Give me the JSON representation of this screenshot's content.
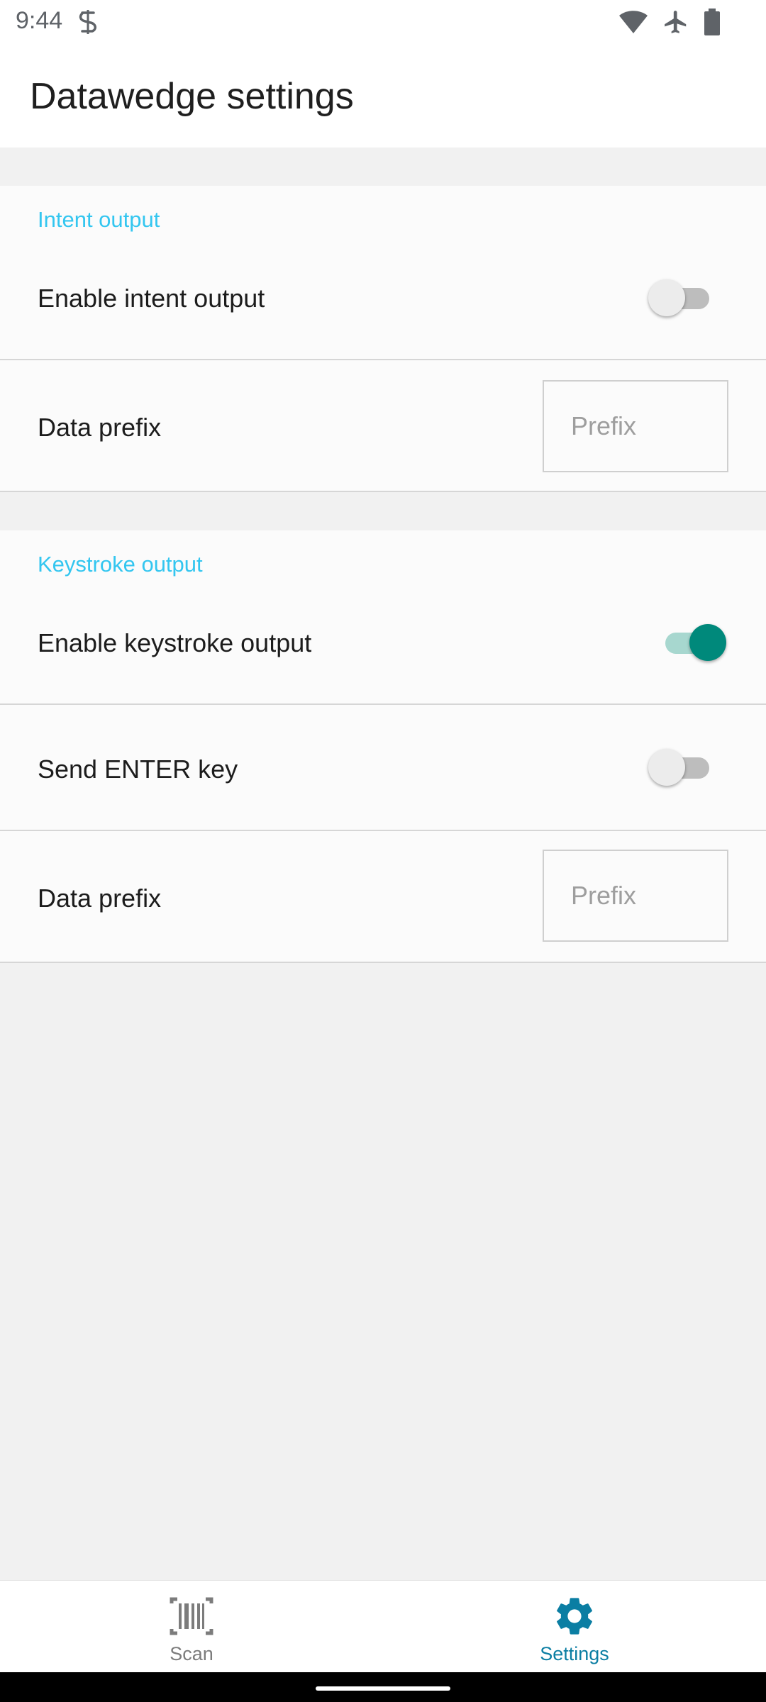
{
  "status_bar": {
    "time": "9:44"
  },
  "header": {
    "title": "Datawedge settings"
  },
  "sections": [
    {
      "header": "Intent output",
      "rows": [
        {
          "label": "Enable intent output",
          "control": "switch",
          "checked": false
        },
        {
          "label": "Data prefix",
          "control": "input",
          "placeholder": "Prefix",
          "value": ""
        }
      ]
    },
    {
      "header": "Keystroke output",
      "rows": [
        {
          "label": "Enable keystroke output",
          "control": "switch",
          "checked": true
        },
        {
          "label": "Send ENTER key",
          "control": "switch",
          "checked": false
        },
        {
          "label": "Data prefix",
          "control": "input",
          "placeholder": "Prefix",
          "value": ""
        }
      ]
    }
  ],
  "bottom_nav": {
    "items": [
      {
        "label": "Scan",
        "icon": "barcode-icon",
        "selected": false
      },
      {
        "label": "Settings",
        "icon": "gear-icon",
        "selected": true
      }
    ]
  },
  "colors": {
    "accent": "#33c6f0",
    "switch_on": "#00897b",
    "nav_selected": "#0b7ea3",
    "nav_unselected": "#7c7c7c"
  }
}
